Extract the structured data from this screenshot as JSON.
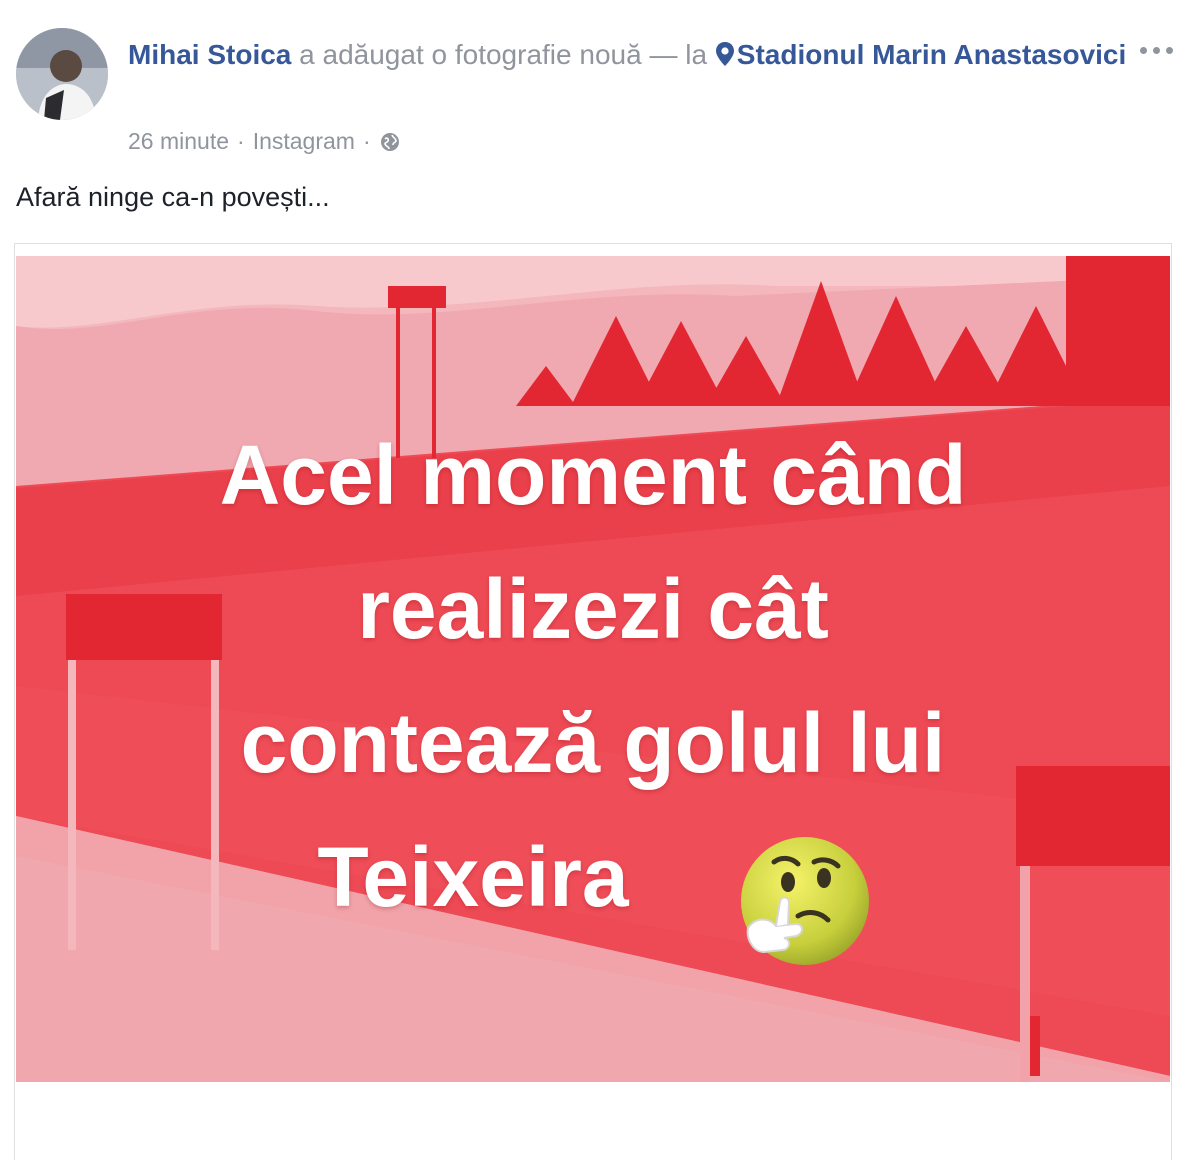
{
  "post": {
    "author": "Mihai Stoica",
    "action": "a adăugat o fotografie nouă — la",
    "location": "Stadionul Marin Anastasovici",
    "time": "26 minute",
    "separator": "·",
    "source": "Instagram",
    "caption": "Afară ninge ca-n povești..."
  },
  "photo": {
    "text_lines": [
      "Acel moment când",
      "realizezi cât",
      "contează golul lui",
      "Teixeira"
    ],
    "emoji_icon": "thinking-face-icon"
  },
  "colors": {
    "link": "#365899",
    "meta_text": "#90949c",
    "meme_red": "#e83540",
    "meme_pink": "#f4a9ae"
  }
}
